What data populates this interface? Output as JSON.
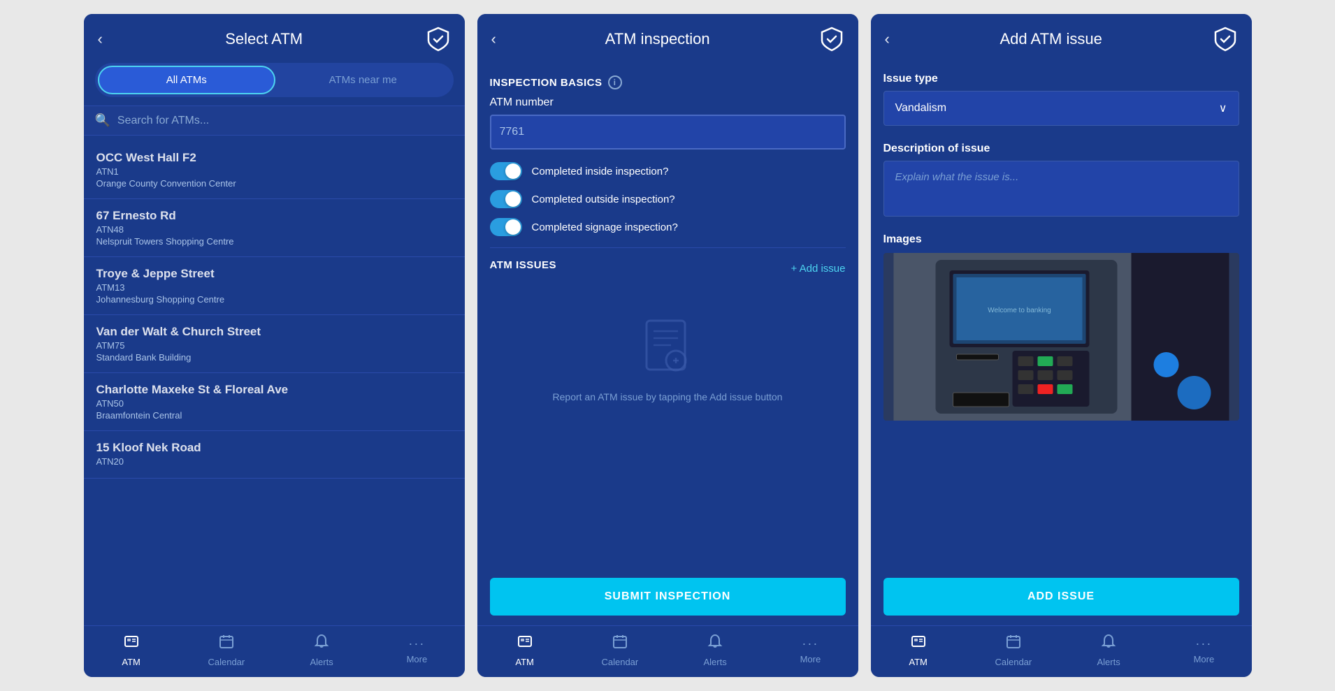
{
  "screen1": {
    "title": "Select ATM",
    "tabs": [
      "All ATMs",
      "ATMs near me"
    ],
    "active_tab": 0,
    "search_placeholder": "Search for ATMs...",
    "atms": [
      {
        "name": "OCC West Hall F2",
        "code": "ATN1",
        "location": "Orange County Convention Center"
      },
      {
        "name": "67 Ernesto Rd",
        "code": "ATN48",
        "location": "Nelspruit Towers Shopping Centre"
      },
      {
        "name": "Troye & Jeppe Street",
        "code": "ATM13",
        "location": "Johannesburg Shopping Centre"
      },
      {
        "name": "Van der Walt & Church Street",
        "code": "ATM75",
        "location": "Standard Bank Building"
      },
      {
        "name": "Charlotte Maxeke St & Floreal Ave",
        "code": "ATN50",
        "location": "Braamfontein Central"
      },
      {
        "name": "15 Kloof Nek Road",
        "code": "ATN20",
        "location": ""
      }
    ],
    "nav": [
      {
        "icon": "📋",
        "label": "ATM",
        "active": true
      },
      {
        "icon": "📅",
        "label": "Calendar",
        "active": false
      },
      {
        "icon": "🔔",
        "label": "Alerts",
        "active": false
      },
      {
        "icon": "···",
        "label": "More",
        "active": false
      }
    ]
  },
  "screen2": {
    "title": "ATM inspection",
    "section_basics": "INSPECTION BASICS",
    "field_atm_number": "ATM number",
    "atm_number_value": "7761",
    "toggles": [
      {
        "label": "Completed inside inspection?",
        "on": true
      },
      {
        "label": "Completed outside inspection?",
        "on": true
      },
      {
        "label": "Completed signage inspection?",
        "on": true
      }
    ],
    "section_issues": "ATM ISSUES",
    "add_issue_label": "+ Add issue",
    "empty_state_text": "Report an ATM issue by\ntapping the Add issue button",
    "submit_btn": "SUBMIT INSPECTION",
    "nav": [
      {
        "icon": "📋",
        "label": "ATM",
        "active": true
      },
      {
        "icon": "📅",
        "label": "Calendar",
        "active": false
      },
      {
        "icon": "🔔",
        "label": "Alerts",
        "active": false
      },
      {
        "icon": "···",
        "label": "More",
        "active": false
      }
    ]
  },
  "screen3": {
    "title": "Add ATM issue",
    "issue_type_label": "Issue type",
    "issue_type_value": "Vandalism",
    "description_label": "Description of issue",
    "description_placeholder": "Explain what the issue is...",
    "images_label": "Images",
    "add_issue_btn": "ADD ISSUE",
    "nav": [
      {
        "icon": "📋",
        "label": "ATM",
        "active": true
      },
      {
        "icon": "📅",
        "label": "Calendar",
        "active": false
      },
      {
        "icon": "🔔",
        "label": "Alerts",
        "active": false
      },
      {
        "icon": "···",
        "label": "More",
        "active": false
      }
    ]
  },
  "icons": {
    "back": "‹",
    "shield": "🛡",
    "search": "🔍",
    "info": "i",
    "plus": "+",
    "chevron_down": "∨",
    "empty_notepad": "📋"
  },
  "colors": {
    "primary_bg": "#1a3a8a",
    "header_bg": "#1a3a8a",
    "field_bg": "#2244a8",
    "accent": "#00c4f0",
    "toggle_on": "#2a9de0"
  }
}
